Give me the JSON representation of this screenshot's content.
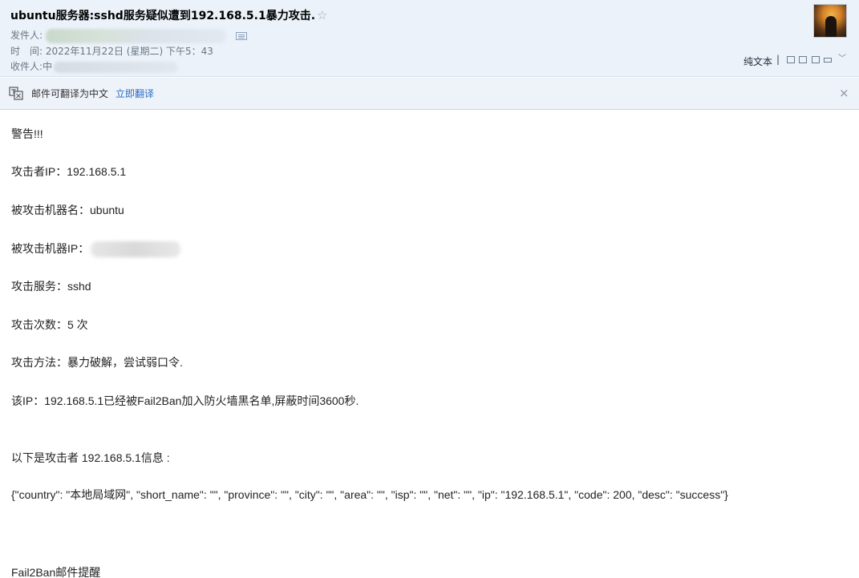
{
  "email": {
    "subject": "ubuntu服务器:sshd服务疑似遭到192.168.5.1暴力攻击.",
    "star_icon": "star-outline-icon",
    "from_label": "发件人:",
    "time_label": "时　间:",
    "time_value": "2022年11月22日 (星期二) 下午5：43",
    "to_label": "收件人:",
    "to_value_visible": "中"
  },
  "toolbar": {
    "plain_text": "纯文本",
    "separator": "|",
    "icons": [
      "window-icon",
      "copy-icon",
      "print-preview-icon",
      "print-icon",
      "chevron-down-icon"
    ]
  },
  "translate": {
    "message": "邮件可翻译为中文",
    "action": "立即翻译",
    "close": "×"
  },
  "content": {
    "warning": "警告!!!",
    "attacker_ip": "攻击者IP：192.168.5.1",
    "target_host": "被攻击机器名：ubuntu",
    "target_ip_label": "被攻击机器IP：",
    "service": "攻击服务：sshd",
    "count": "攻击次数：5 次",
    "method": "攻击方法：暴力破解，尝试弱口令.",
    "banned": "该IP：192.168.5.1已经被Fail2Ban加入防火墙黑名单,屏蔽时间3600秒.",
    "info_header": "以下是攻击者 192.168.5.1信息 :",
    "json_info": "{\"country\": \"本地局域网\", \"short_name\": \"\", \"province\": \"\", \"city\": \"\", \"area\": \"\", \"isp\": \"\", \"net\": \"\", \"ip\": \"192.168.5.1\", \"code\": 200, \"desc\": \"success\"}",
    "footer": "Fail2Ban邮件提醒"
  }
}
